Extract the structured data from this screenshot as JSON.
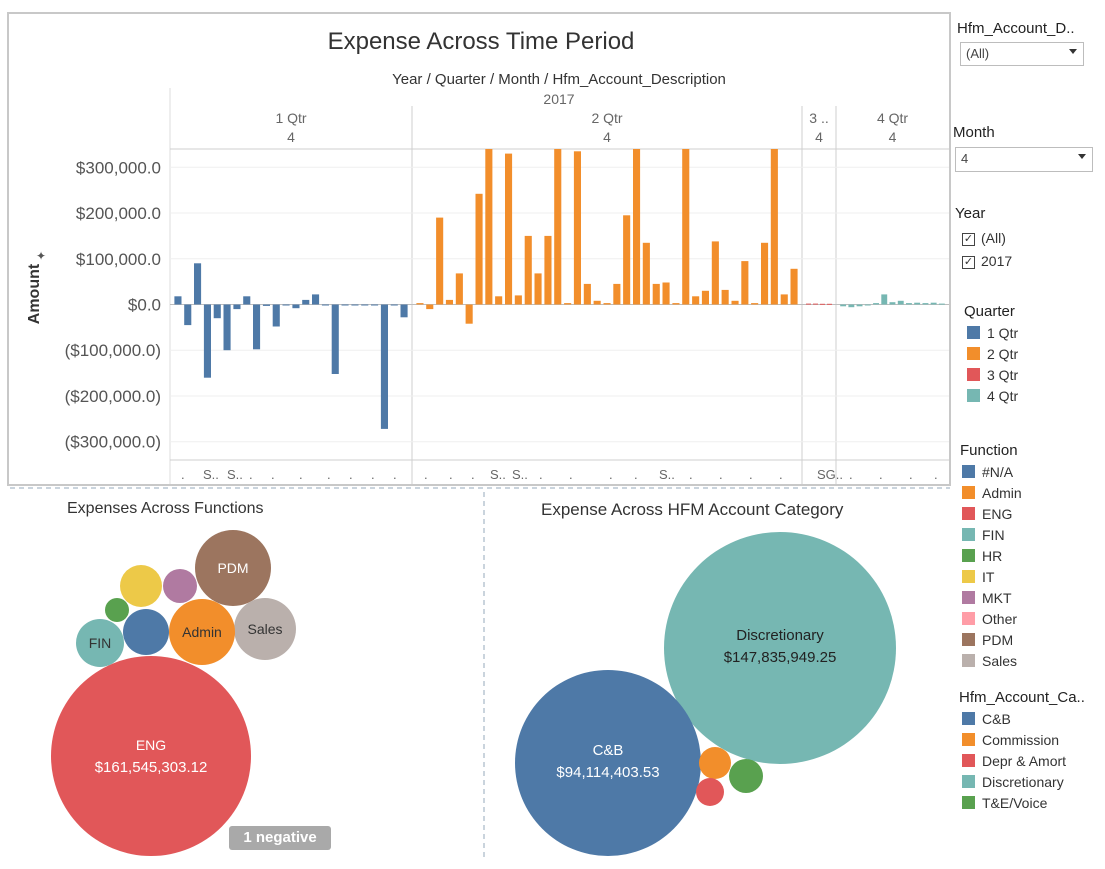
{
  "main_chart": {
    "title": "Expense Across Time Period",
    "header_path": "Year / Quarter / Month / Hfm_Account_Description",
    "year": "2017",
    "quarters": [
      {
        "label": "1 Qtr",
        "month": "4"
      },
      {
        "label": "2 Qtr",
        "month": "4"
      },
      {
        "label": "3 ..",
        "month": "4"
      },
      {
        "label": "4 Qtr",
        "month": "4"
      }
    ],
    "ylabel": "Amount",
    "yticks": [
      "$300,000.0",
      "$200,000.0",
      "$100,000.0",
      "$0.0",
      "($100,000.0)",
      "($200,000.0)",
      "($300,000.0)"
    ],
    "bottom_labels": [
      ".",
      "S..",
      "S..",
      "S..",
      "S..",
      "S..",
      "SG.."
    ]
  },
  "chart_data": [
    {
      "type": "bar",
      "title": "Expense Across Time Period",
      "xlabel": "Year / Quarter / Month / Hfm_Account_Description",
      "ylabel": "Amount",
      "ylim": [
        -340000,
        340000
      ],
      "series": [
        {
          "name": "1 Qtr",
          "values": [
            18000,
            -45000,
            90000,
            -160000,
            -30000,
            -100000,
            -10000,
            18000,
            -98000,
            -3000,
            -48000,
            -2000,
            -8000,
            10000,
            22000,
            -2000,
            -152000,
            -2000,
            -1000,
            -2000,
            -1000,
            -272000,
            -2000,
            -28000
          ]
        },
        {
          "name": "2 Qtr",
          "values": [
            3000,
            -10000,
            190000,
            10000,
            68000,
            -42000,
            242000,
            340000,
            18000,
            330000,
            20000,
            150000,
            68000,
            150000,
            340000,
            3000,
            335000,
            45000,
            8000,
            3000,
            45000,
            195000,
            340000,
            135000,
            45000,
            48000,
            3000,
            340000,
            18000,
            30000,
            138000,
            32000,
            8000,
            95000,
            3000,
            135000,
            340000,
            22000,
            78000
          ]
        },
        {
          "name": "3 Qtr",
          "values": [
            2000,
            2000,
            1500,
            1500
          ]
        },
        {
          "name": "4 Qtr",
          "values": [
            -4000,
            -6000,
            -4000,
            -2000,
            3000,
            22000,
            5000,
            8000,
            3000,
            4000,
            3000,
            4000,
            2000
          ]
        }
      ],
      "grid": true
    },
    {
      "type": "bubble",
      "title": "Expenses Across Functions",
      "bubbles": [
        {
          "label": "ENG",
          "value": 161545303.12,
          "value_label": "$161,545,303.12",
          "category": "ENG"
        },
        {
          "label": "PDM",
          "category": "PDM"
        },
        {
          "label": "Sales",
          "category": "Sales"
        },
        {
          "label": "Admin",
          "category": "Admin"
        },
        {
          "label": "FIN",
          "category": "FIN"
        },
        {
          "label": "",
          "category": "#N/A"
        },
        {
          "label": "",
          "category": "IT"
        },
        {
          "label": "",
          "category": "MKT"
        },
        {
          "label": "",
          "category": "HR"
        }
      ],
      "note": "1 negative"
    },
    {
      "type": "bubble",
      "title": "Expense Across HFM Account Category",
      "bubbles": [
        {
          "label": "Discretionary",
          "value": 147835949.25,
          "value_label": "$147,835,949.25",
          "category": "Discretionary"
        },
        {
          "label": "C&B",
          "value": 94114403.53,
          "value_label": "$94,114,403.53",
          "category": "C&B"
        },
        {
          "label": "",
          "category": "Commission"
        },
        {
          "label": "",
          "category": "T&E/Voice"
        },
        {
          "label": "",
          "category": "Depr & Amort"
        }
      ]
    }
  ],
  "bubble_titles": {
    "functions": "Expenses Across Functions",
    "hfm": "Expense Across HFM Account Category",
    "note": "1 negative"
  },
  "filters": {
    "hfm_account_desc": {
      "title": "Hfm_Account_D..",
      "value": "(All)"
    },
    "month": {
      "title": "Month",
      "value": "4"
    },
    "year": {
      "title": "Year",
      "options": [
        "(All)",
        "2017"
      ]
    }
  },
  "legends": {
    "quarter": {
      "title": "Quarter",
      "items": [
        "1 Qtr",
        "2 Qtr",
        "3 Qtr",
        "4 Qtr"
      ]
    },
    "function": {
      "title": "Function",
      "items": [
        "#N/A",
        "Admin",
        "ENG",
        "FIN",
        "HR",
        "IT",
        "MKT",
        "Other",
        "PDM",
        "Sales"
      ]
    },
    "hfm_category": {
      "title": "Hfm_Account_Ca..",
      "items": [
        "C&B",
        "Commission",
        "Depr & Amort",
        "Discretionary",
        "T&E/Voice"
      ]
    }
  },
  "colors": {
    "q1": "#4e79a7",
    "q2": "#f28e2b",
    "q3": "#e15759",
    "q4": "#76b7b2",
    "#N/A": "#4e79a7",
    "Admin": "#f28e2b",
    "ENG": "#e15759",
    "FIN": "#76b7b2",
    "HR": "#59a14f",
    "IT": "#edc948",
    "MKT": "#b07aa1",
    "Other": "#ff9da7",
    "PDM": "#9c755f",
    "Sales": "#bab0ac",
    "C&B": "#4e79a7",
    "Commission": "#f28e2b",
    "Depr & Amort": "#e15759",
    "Discretionary": "#76b7b2",
    "T&E/Voice": "#59a14f"
  }
}
